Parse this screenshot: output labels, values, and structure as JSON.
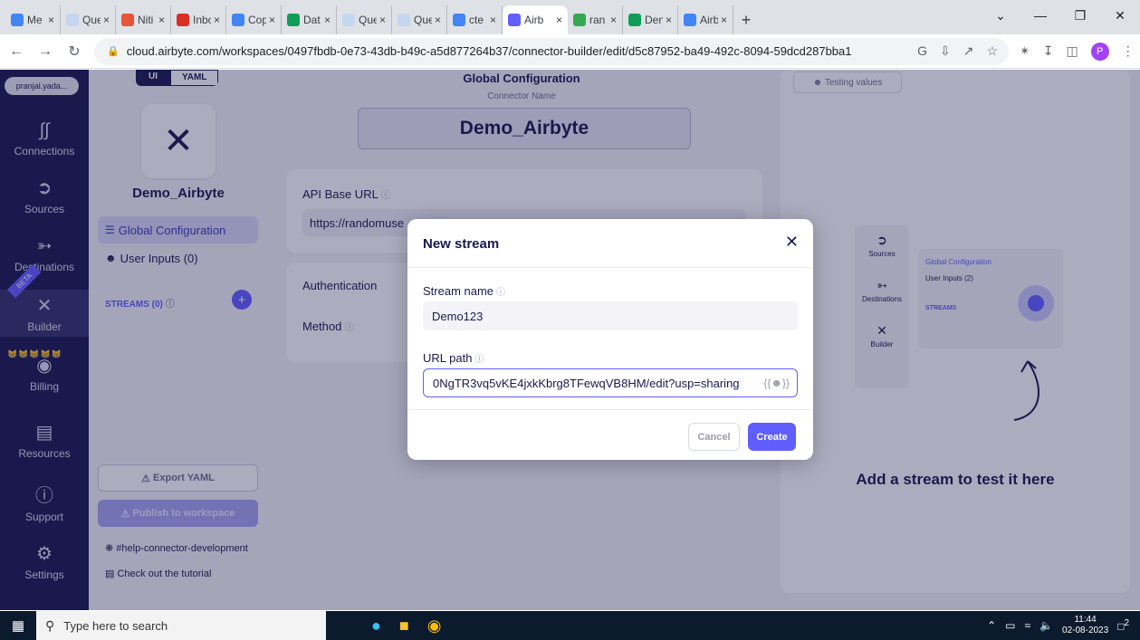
{
  "browser": {
    "tabs": [
      {
        "label": "Me",
        "color": "#4285f4"
      },
      {
        "label": "Que",
        "color": "#c5d6f0"
      },
      {
        "label": "Niti",
        "color": "#e8543a"
      },
      {
        "label": "Inbo",
        "color": "#d93025"
      },
      {
        "label": "Cop",
        "color": "#4285f4"
      },
      {
        "label": "Dat",
        "color": "#0f9d58"
      },
      {
        "label": "Que",
        "color": "#c5d6f0"
      },
      {
        "label": "Que",
        "color": "#c5d6f0"
      },
      {
        "label": "cte",
        "color": "#4285f4"
      },
      {
        "label": "Airb",
        "color": "#615eff"
      },
      {
        "label": "ran",
        "color": "#34a853"
      },
      {
        "label": "Den",
        "color": "#0f9d58"
      },
      {
        "label": "Airb",
        "color": "#4285f4"
      }
    ],
    "url": "cloud.airbyte.com/workspaces/0497fbdb-0e73-43db-b49c-a5d877264b37/connector-builder/edit/d5c87952-ba49-492c-8094-59dcd287bba1",
    "profile_initial": "P"
  },
  "nav": {
    "user": "pranjal.yada...",
    "items": [
      {
        "label": "Connections",
        "icon": "connections-icon"
      },
      {
        "label": "Sources",
        "icon": "sources-icon"
      },
      {
        "label": "Destinations",
        "icon": "destinations-icon"
      },
      {
        "label": "Builder",
        "icon": "builder-icon"
      },
      {
        "label": "Billing",
        "icon": "billing-icon"
      },
      {
        "label": "Resources",
        "icon": "resources-icon"
      },
      {
        "label": "Support",
        "icon": "support-icon"
      },
      {
        "label": "Settings",
        "icon": "settings-icon"
      }
    ],
    "beta": "BETA"
  },
  "builder": {
    "toggle_ui": "UI",
    "toggle_yaml": "YAML",
    "name": "Demo_Airbyte",
    "global_config": "Global Configuration",
    "user_inputs": "User Inputs (0)",
    "streams": "STREAMS (0)",
    "export_yaml": "Export YAML",
    "publish": "Publish to workspace",
    "help": "#help-connector-development",
    "tutorial": "Check out the tutorial"
  },
  "main": {
    "title": "Global Configuration",
    "connector_name_label": "Connector Name",
    "connector_name": "Demo_Airbyte",
    "api_base_url_label": "API Base URL",
    "api_base_url": "https://randomuse",
    "authentication_label": "Authentication",
    "method_label": "Method"
  },
  "right": {
    "testing_values": "Testing values",
    "mini_sources": "Sources",
    "mini_destinations": "Destinations",
    "mini_builder": "Builder",
    "mini_global": "Global Configuration",
    "mini_user_inputs": "User Inputs (2)",
    "mini_streams": "STREAMS",
    "add_stream": "Add a stream to test it here"
  },
  "modal": {
    "title": "New stream",
    "stream_name_label": "Stream name",
    "stream_name_value": "Demo123",
    "url_path_label": "URL path",
    "url_path_value": "0NgTR3vq5vKE4jxkKbrg8TFewqVB8HM/edit?usp=sharing",
    "cancel": "Cancel",
    "create": "Create"
  },
  "taskbar": {
    "search_placeholder": "Type here to search",
    "time": "11:44",
    "date": "02-08-2023",
    "notif_count": "2"
  },
  "colors": {
    "accent": "#615eff",
    "nav_bg": "#1a194d"
  }
}
